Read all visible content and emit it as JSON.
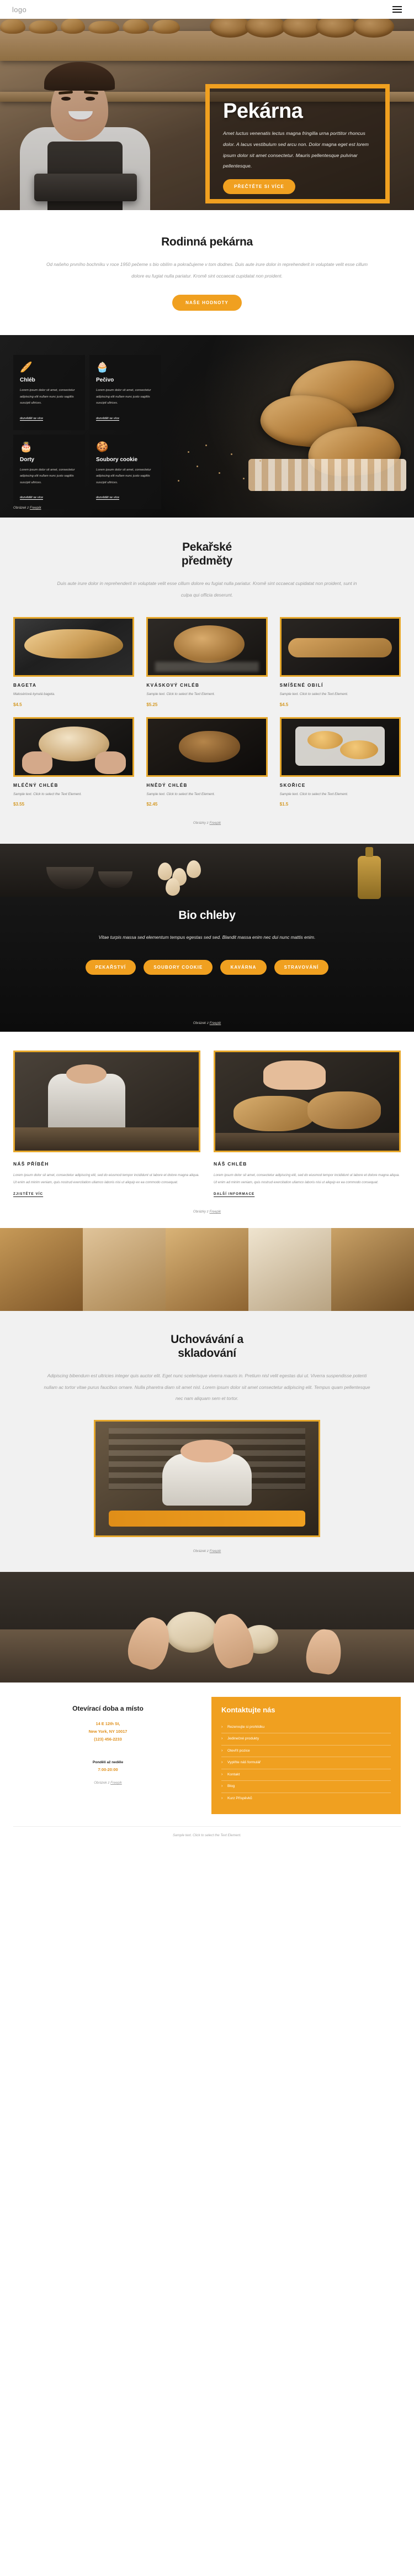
{
  "header": {
    "logo": "logo",
    "menu_icon": "hamburger-menu-icon"
  },
  "hero": {
    "title": "Pekárna",
    "paragraph": "Amet luctus venenatis lectus magna fringilla urna porttitor rhoncus dolor. A lacus vestibulum sed arcu non. Dolor magna eget est lorem ipsum dolor sit amet consectetur. Mauris pellentesque pulvinar pellentesque.",
    "cta": "PŘEČTĚTE SI VÍCE"
  },
  "family": {
    "title": "Rodinná pekárna",
    "paragraph": "Od našeho prvního bochníku v roce 1950 pečeme s bio obilím a pokračujeme v tom dodnes. Duis aute irure dolor in reprehenderit in voluptate velit esse cillum dolore eu fugiat nulla pariatur. Kromě sint occaecat cupidatat non proident.",
    "cta": "NAŠE HODNOTY"
  },
  "categories": {
    "credit_prefix": "Obrázek z ",
    "credit_link": "Freepik",
    "items": [
      {
        "icon": "bread-baguette-icon",
        "glyph": "🥖",
        "title": "Chléb",
        "text": "Lorem ipsum dolor sit amet, consectetur adipiscing elit nullam nunc justo sagittis suscipit ultrices.",
        "link": "dozvědět se více"
      },
      {
        "icon": "cupcake-icon",
        "glyph": "🧁",
        "title": "Pečivo",
        "text": "Lorem ipsum dolor sit amet, consectetur adipiscing elit nullam nunc justo sagittis suscipit ultrices.",
        "link": "dozvědět se více"
      },
      {
        "icon": "cake-icon",
        "glyph": "🎂",
        "title": "Dorty",
        "text": "Lorem ipsum dolor sit amet, consectetur adipiscing elit nullam nunc justo sagittis suscipit ultrices.",
        "link": "dozvědět se více"
      },
      {
        "icon": "cookie-icon",
        "glyph": "🍪",
        "title": "Soubory cookie",
        "text": "Lorem ipsum dolor sit amet, consectetur adipiscing elit nullam nunc justo sagittis suscipit ultrices.",
        "link": "dozvědět se více"
      }
    ]
  },
  "products": {
    "title_line1": "Pekařské",
    "title_line2": "předměty",
    "paragraph": "Duis aute irure dolor in reprehenderit in voluptate velit esse cillum dolore eu fugiat nulla pariatur. Kromě sint occaecat cupidatat non proident, sunt in culpa qui officia deserunt.",
    "credit_prefix": "Obrázky z ",
    "credit_link": "Freepik",
    "items": [
      {
        "name": "BAGETA",
        "desc": "Malosériová kynutá bageta.",
        "price": "$4.5"
      },
      {
        "name": "KVÁSKOVÝ CHLÉB",
        "desc": "Sample text. Click to select the Text Element.",
        "price": "$5.25"
      },
      {
        "name": "SMÍŠENÉ OBILÍ",
        "desc": "Sample text. Click to select the Text Element.",
        "price": "$4.5"
      },
      {
        "name": "MLÉČNÝ CHLÉB",
        "desc": "Sample text. Click to select the Text Element.",
        "price": "$3.55"
      },
      {
        "name": "HNĚDÝ CHLÉB",
        "desc": "Sample text. Click to select the Text Element.",
        "price": "$2.45"
      },
      {
        "name": "SKOŘICE",
        "desc": "Sample text. Click to select the Text Element.",
        "price": "$1.5"
      }
    ]
  },
  "bio": {
    "title": "Bio chleby",
    "paragraph": "Vitae turpis massa sed elementum tempus egestas sed sed. Blandit massa enim nec dui nunc mattis enim.",
    "buttons": [
      "PEKAŘSTVÍ",
      "SOUBORY COOKIE",
      "KAVÁRNA",
      "STRAVOVÁNÍ"
    ],
    "credit_prefix": "Obrázek z ",
    "credit_link": "Freepik"
  },
  "story": {
    "credit_prefix": "Obrázky z ",
    "credit_link": "Freepik",
    "items": [
      {
        "title": "NÁŠ PŘÍBĚH",
        "text": "Lorem ipsum dolor sit amet, consectetur adipiscing elit, sed do eiusmod tempor incididunt ut labore et dolore magna aliqua. Ut enim ad minim veniam, quis nostrud exercitation ullamco laboris nisi ut aliquip ex ea commodo consequat.",
        "link": "ZJISTĚTE VÍC"
      },
      {
        "title": "NÁŠ CHLÉB",
        "text": "Lorem ipsum dolor sit amet, consectetur adipiscing elit, sed do eiusmod tempor incididunt ut labore et dolore magna aliqua. Ut enim ad minim veniam, quis nostrud exercitation ullamco laboris nisi ut aliquip ex ea commodo consequat.",
        "link": "DALŠÍ INFORMACE"
      }
    ]
  },
  "storage": {
    "title_line1": "Uchovávání a",
    "title_line2": "skladování",
    "paragraph": "Adipiscing bibendum est ultricies integer quis auctor elit. Eget nunc scelerisque viverra mauris in. Pretium nisl velit egestas dui ut. Viverra suspendisse potenti nullam ac tortor vitae purus faucibus ornare. Nulla pharetra diam sit amet nisl. Lorem ipsum dolor sit amet consectetur adipiscing elit. Tempus quam pellentesque nec nam aliquam sem et tortor.",
    "credit_prefix": "Obrázek z ",
    "credit_link": "Freepik"
  },
  "footer": {
    "hours": {
      "title": "Otevírací doba a místo",
      "address_line1": "14 E 12th St,",
      "address_line2": "New York, NY 10017",
      "phone": "(123) 456-2233",
      "label": "Pondělí až neděle",
      "time": "7:00-20:00",
      "credit_prefix": "Obrázek z ",
      "credit_link": "Freepik"
    },
    "contact": {
      "title": "Kontaktujte nás",
      "links": [
        "Rezervujte si prohlídku",
        "Jedinečné produkty",
        "Otevřít pozice",
        "Vyplňte náš formulář",
        "Kontakt",
        "Blog",
        "Kurz Příspěvků"
      ]
    },
    "bottom": "Sample text. Click to select the Text Element."
  },
  "colors": {
    "accent": "#f0a020",
    "price": "#d49a27",
    "dark": "#131313"
  }
}
